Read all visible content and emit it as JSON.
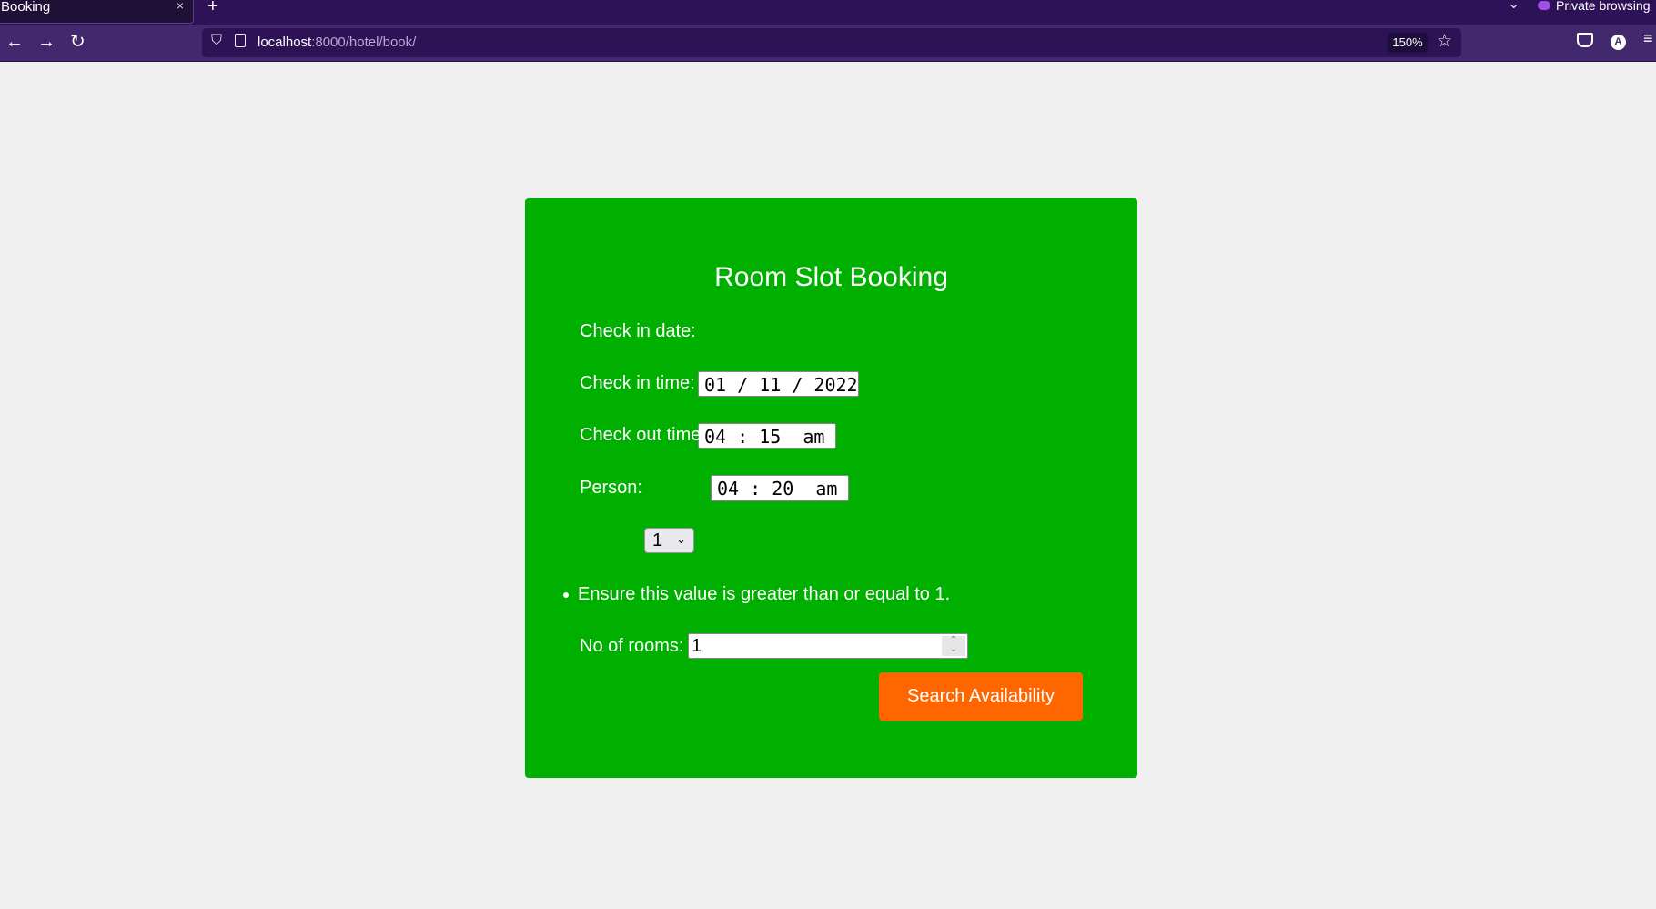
{
  "browser": {
    "tab_title": "Booking",
    "tab_close": "×",
    "new_tab": "+",
    "private_label": "Private browsing",
    "url_host": "localhost",
    "url_rest": ":8000/hotel/book/",
    "zoom_level": "150%",
    "account_initial": "A"
  },
  "form": {
    "title": "Room Slot Booking",
    "check_in_date_label": "Check in date:",
    "check_in_date_value": "01 / 11 / 2022",
    "check_in_time_label": "Check in time:",
    "check_in_time_value": "04 : 15  am",
    "check_out_time_label": "Check out time:",
    "check_out_time_value": "04 : 20  am",
    "person_label": "Person:",
    "person_value": "1",
    "error_message": "Ensure this value is greater than or equal to 1.",
    "rooms_label": "No of rooms:",
    "rooms_value": "1",
    "submit_label": "Search Availability"
  },
  "colors": {
    "card": "#00b000",
    "button": "#ff6600",
    "browser_chrome": "#42286c"
  }
}
